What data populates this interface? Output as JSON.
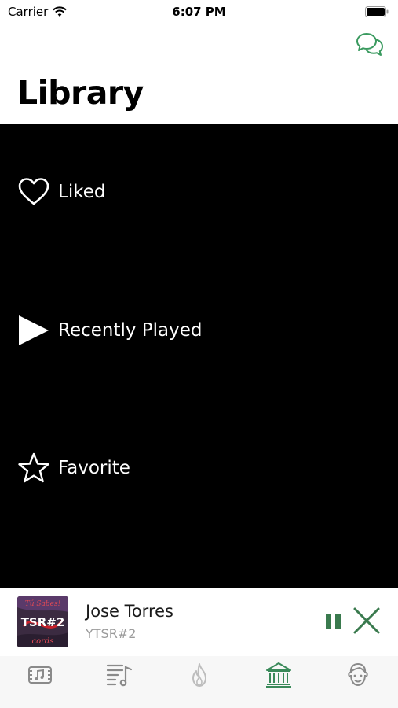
{
  "status_bar": {
    "carrier": "Carrier",
    "time": "6:07 PM"
  },
  "header": {
    "title": "Library",
    "chat_icon": "chat-bubbles-icon"
  },
  "library": {
    "items": [
      {
        "label": "Liked",
        "icon": "heart-icon"
      },
      {
        "label": "Recently Played",
        "icon": "play-icon"
      },
      {
        "label": "Favorite",
        "icon": "star-icon"
      }
    ]
  },
  "now_playing": {
    "title": "Jose Torres",
    "subtitle": "YTSR#2",
    "art_text": "TSR#2",
    "art_top_text": "Tú Sabes!",
    "art_bottom_text": "cords"
  },
  "tabs": [
    {
      "name": "music-video",
      "icon": "film-music-icon",
      "active": false
    },
    {
      "name": "playlist",
      "icon": "playlist-icon",
      "active": false
    },
    {
      "name": "trending",
      "icon": "flame-icon",
      "active": false
    },
    {
      "name": "library",
      "icon": "library-icon",
      "active": true
    },
    {
      "name": "profile",
      "icon": "face-icon",
      "active": false
    }
  ],
  "colors": {
    "accent": "#3a8a5a",
    "inactive_tab": "#8a8a8a",
    "list_background": "#000000"
  }
}
